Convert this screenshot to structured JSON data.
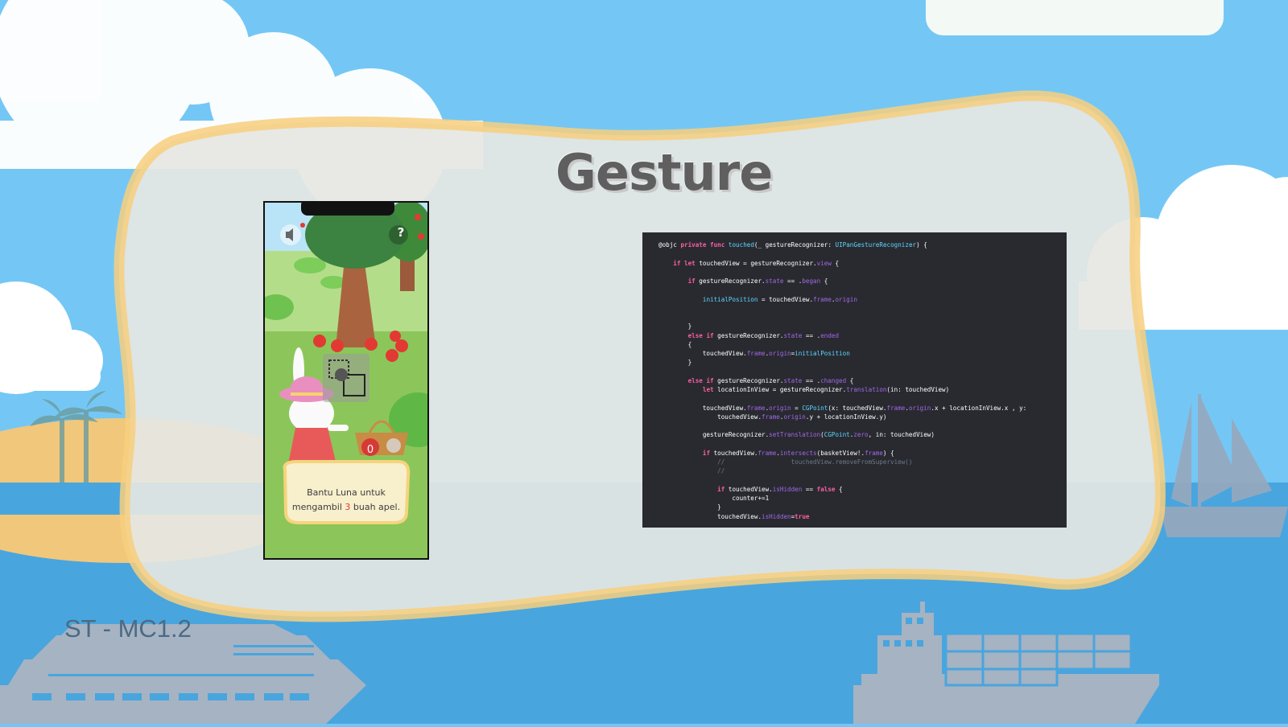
{
  "slide": {
    "title": "Gesture",
    "deck_label": "ST - MC1.2"
  },
  "phone_screen": {
    "sound_icon": "speaker-icon",
    "help_label": "?",
    "basket_count": "0",
    "instruction_line1": "Bantu Luna untuk",
    "instruction_pre": "mengambil ",
    "instruction_number": "3",
    "instruction_post": " buah apel."
  },
  "code_block": {
    "lines": [
      {
        "text": "@objc private func touched(_ gestureRecognizer: UIPanGestureRecognizer) {"
      },
      {
        "text": ""
      },
      {
        "text": "    if let touchedView = gestureRecognizer.view {"
      },
      {
        "text": ""
      },
      {
        "text": "        if gestureRecognizer.state == .began {"
      },
      {
        "text": ""
      },
      {
        "text": "            initialPosition = touchedView.frame.origin"
      },
      {
        "text": ""
      },
      {
        "text": ""
      },
      {
        "text": "        }"
      },
      {
        "text": "        else if gestureRecognizer.state == .ended"
      },
      {
        "text": "        {"
      },
      {
        "text": "            touchedView.frame.origin=initialPosition"
      },
      {
        "text": "        }"
      },
      {
        "text": ""
      },
      {
        "text": "        else if gestureRecognizer.state == .changed {"
      },
      {
        "text": "            let locationInView = gestureRecognizer.translation(in: touchedView)"
      },
      {
        "text": ""
      },
      {
        "text": "            touchedView.frame.origin = CGPoint(x: touchedView.frame.origin.x + locationInView.x , y:"
      },
      {
        "text": "                touchedView.frame.origin.y + locationInView.y)"
      },
      {
        "text": ""
      },
      {
        "text": "            gestureRecognizer.setTranslation(CGPoint.zero, in: touchedView)"
      },
      {
        "text": ""
      },
      {
        "text": "            if touchedView.frame.intersects(basketView!.frame) {"
      },
      {
        "text": "                //                  touchedView.removeFromSuperview()"
      },
      {
        "text": "                //"
      },
      {
        "text": ""
      },
      {
        "text": "                if touchedView.isHidden == false {"
      },
      {
        "text": "                    counter+=1"
      },
      {
        "text": "                }"
      },
      {
        "text": "                touchedView.isHidden=true"
      }
    ]
  },
  "colors": {
    "sky": "#73c6f4",
    "sea": "#47a2dc",
    "frame_border": "#f5d08a",
    "panel_fill": "#e6e6e2",
    "code_bg": "#292a30",
    "keyword": "#fc5fa3",
    "type": "#5dd8ff",
    "property": "#a167e6",
    "comment": "#6c7986",
    "ship": "#a9b5c3"
  }
}
